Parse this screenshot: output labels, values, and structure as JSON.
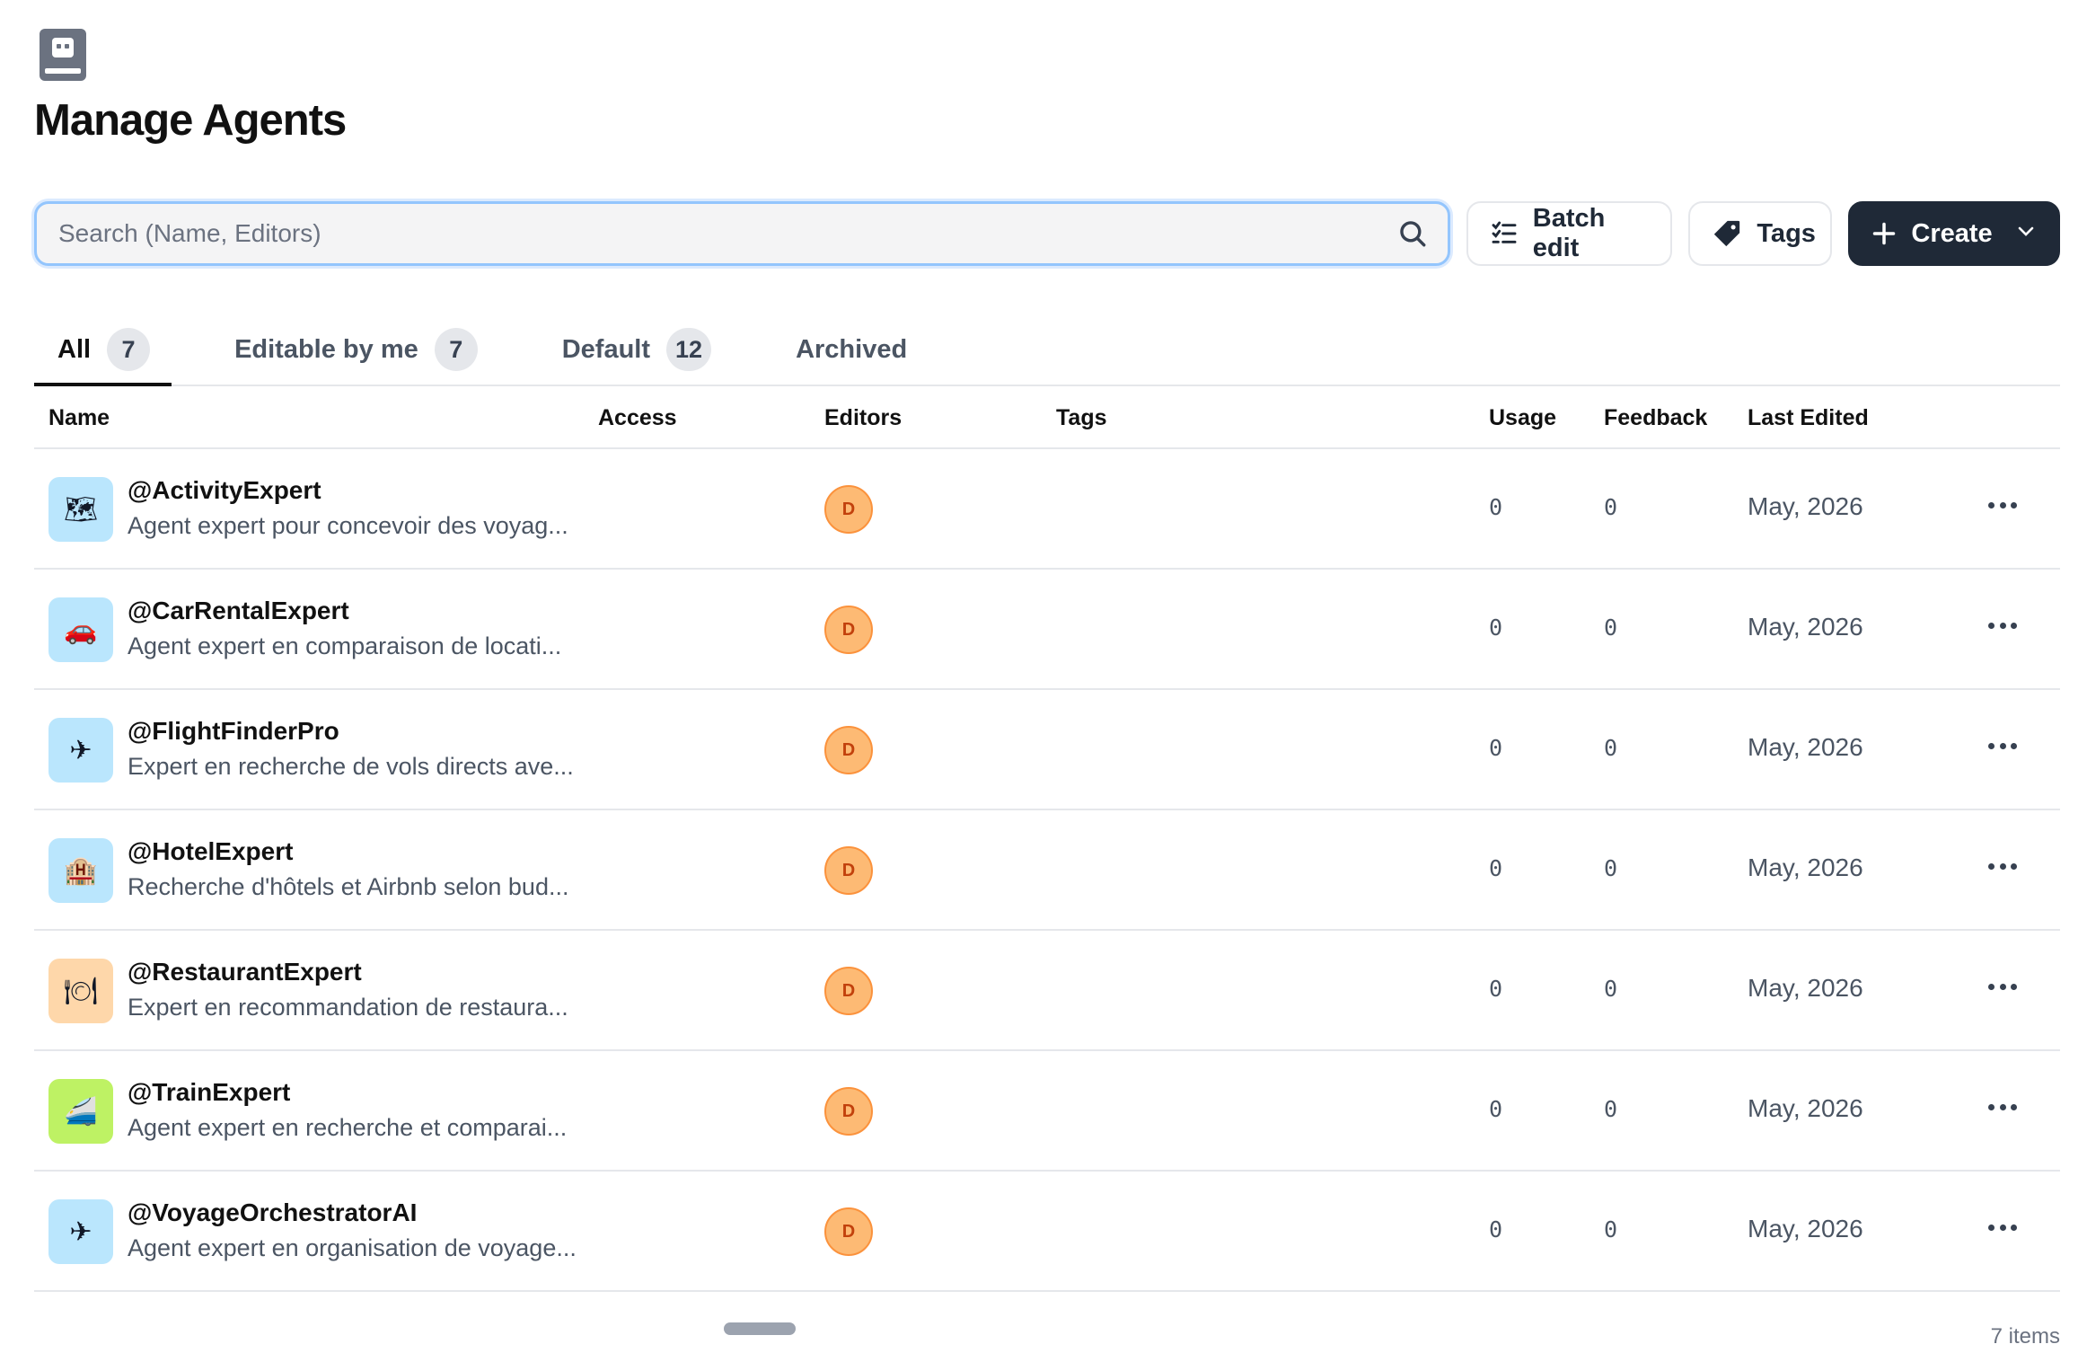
{
  "header": {
    "title": "Manage Agents",
    "icon": "robot-book-icon"
  },
  "search": {
    "placeholder": "Search (Name, Editors)",
    "value": ""
  },
  "toolbar": {
    "batch_edit": "Batch edit",
    "tags": "Tags",
    "create": "Create"
  },
  "tabs": [
    {
      "label": "All",
      "count": "7",
      "active": true
    },
    {
      "label": "Editable by me",
      "count": "7"
    },
    {
      "label": "Default",
      "count": "12"
    },
    {
      "label": "Archived"
    }
  ],
  "columns": {
    "name": "Name",
    "access": "Access",
    "editors": "Editors",
    "tags": "Tags",
    "usage": "Usage",
    "feedback": "Feedback",
    "last_edited": "Last Edited"
  },
  "rows": [
    {
      "name": "@ActivityExpert",
      "description": "Agent expert pour concevoir des voyag...",
      "emoji": "🗺",
      "avatar_bg": "#bae6fd",
      "editor": "D",
      "usage": "0",
      "feedback": "0",
      "last_edited": "May, 2026"
    },
    {
      "name": "@CarRentalExpert",
      "description": "Agent expert en comparaison de locati...",
      "emoji": "🚗",
      "avatar_bg": "#bae6fd",
      "editor": "D",
      "usage": "0",
      "feedback": "0",
      "last_edited": "May, 2026"
    },
    {
      "name": "@FlightFinderPro",
      "description": "Expert en recherche de vols directs ave...",
      "emoji": "✈",
      "avatar_bg": "#bae6fd",
      "editor": "D",
      "usage": "0",
      "feedback": "0",
      "last_edited": "May, 2026"
    },
    {
      "name": "@HotelExpert",
      "description": "Recherche d'hôtels et Airbnb selon bud...",
      "emoji": "🏨",
      "avatar_bg": "#bae6fd",
      "editor": "D",
      "usage": "0",
      "feedback": "0",
      "last_edited": "May, 2026"
    },
    {
      "name": "@RestaurantExpert",
      "description": "Expert en recommandation de restaura...",
      "emoji": "🍽",
      "avatar_bg": "#fed7aa",
      "editor": "D",
      "usage": "0",
      "feedback": "0",
      "last_edited": "May, 2026"
    },
    {
      "name": "@TrainExpert",
      "description": "Agent expert en recherche et comparai...",
      "emoji": "🚄",
      "avatar_bg": "#bef264",
      "editor": "D",
      "usage": "0",
      "feedback": "0",
      "last_edited": "May, 2026"
    },
    {
      "name": "@VoyageOrchestratorAI",
      "description": "Agent expert en organisation de voyage...",
      "emoji": "✈",
      "avatar_bg": "#bae6fd",
      "editor": "D",
      "usage": "0",
      "feedback": "0",
      "last_edited": "May, 2026"
    }
  ],
  "footer": {
    "items_count": "7 items"
  }
}
